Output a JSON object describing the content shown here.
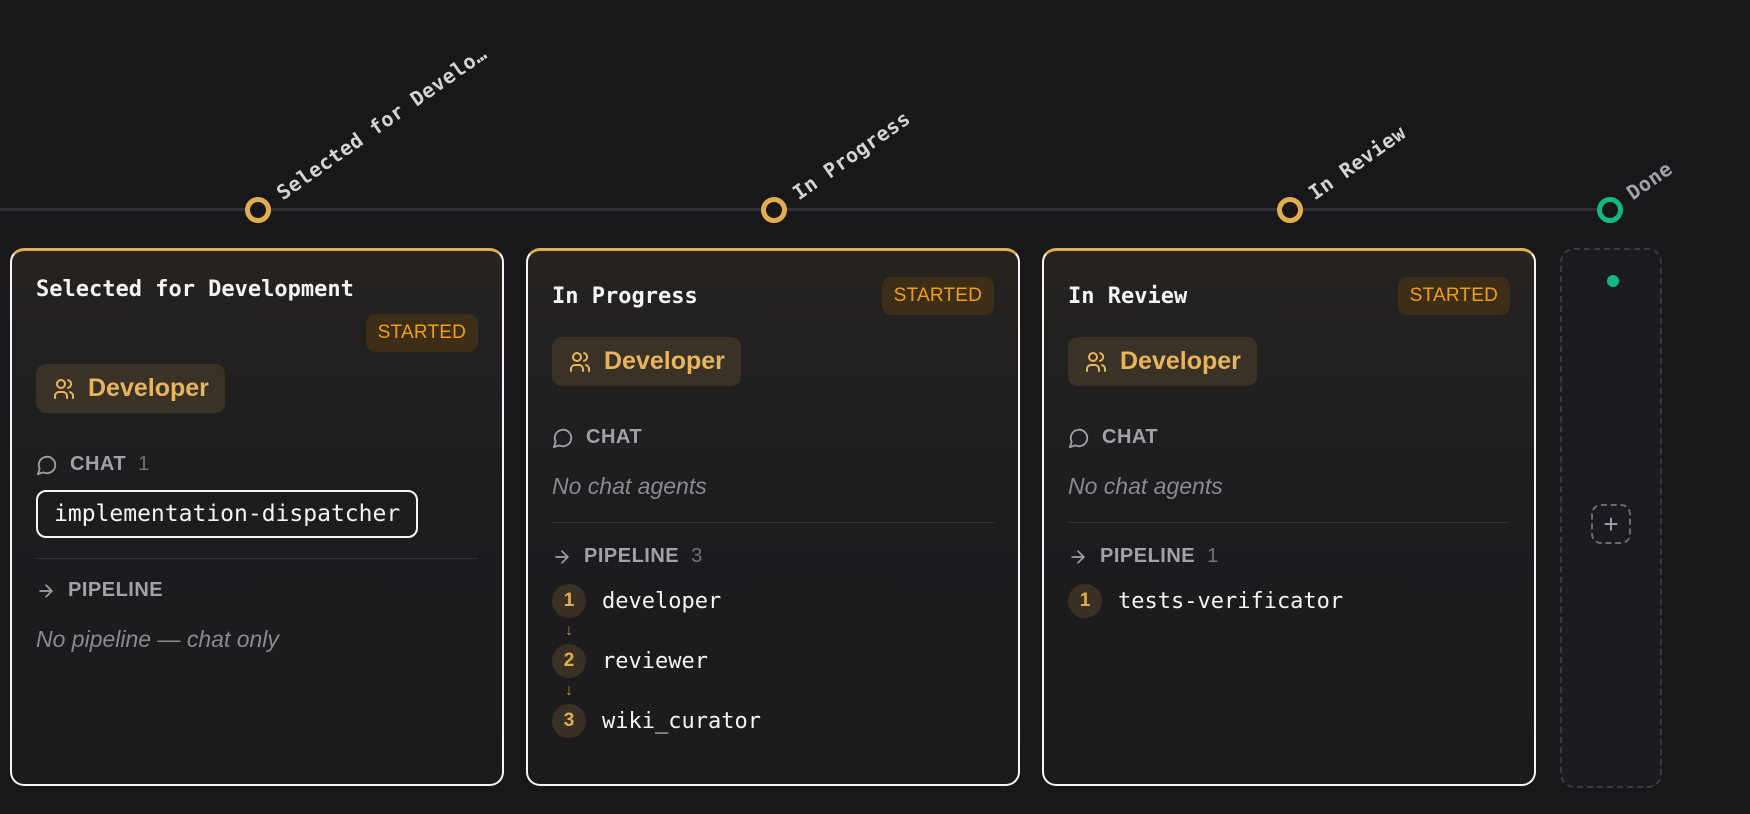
{
  "timeline": {
    "stages": [
      {
        "label": "Selected for Develo…"
      },
      {
        "label": "In Progress"
      },
      {
        "label": "In Review"
      },
      {
        "label": "Done"
      }
    ]
  },
  "columns": [
    {
      "title": "Selected for Development",
      "status": "STARTED",
      "role": "Developer",
      "chat_label": "CHAT",
      "chat_count": "1",
      "chat_agents": [
        "implementation-dispatcher"
      ],
      "pipeline_label": "PIPELINE",
      "pipeline_count": "",
      "pipeline_empty": "No pipeline — chat only"
    },
    {
      "title": "In Progress",
      "status": "STARTED",
      "role": "Developer",
      "chat_label": "CHAT",
      "chat_empty": "No chat agents",
      "pipeline_label": "PIPELINE",
      "pipeline_count": "3",
      "pipeline_steps": [
        {
          "num": "1",
          "name": "developer"
        },
        {
          "num": "2",
          "name": "reviewer"
        },
        {
          "num": "3",
          "name": "wiki_curator"
        }
      ]
    },
    {
      "title": "In Review",
      "status": "STARTED",
      "role": "Developer",
      "chat_label": "CHAT",
      "chat_empty": "No chat agents",
      "pipeline_label": "PIPELINE",
      "pipeline_count": "1",
      "pipeline_steps": [
        {
          "num": "1",
          "name": "tests-verificator"
        }
      ]
    }
  ],
  "done_column": {
    "add_label": "+"
  },
  "colors": {
    "accent": "#e2ad4f",
    "done": "#10b981",
    "status": "#f59e0b"
  }
}
